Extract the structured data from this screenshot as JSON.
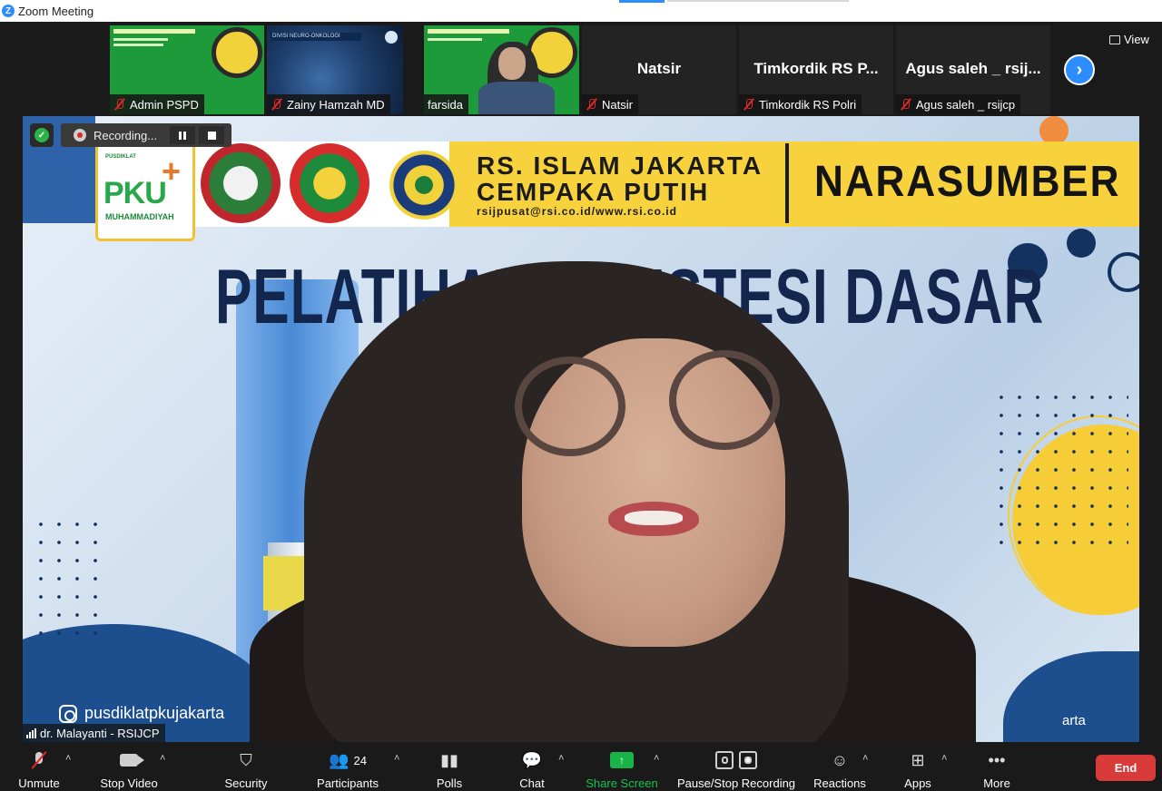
{
  "window": {
    "title": "Zoom Meeting"
  },
  "strip": {
    "tiles": [
      {
        "name": "Admin PSPD",
        "muted": true,
        "kind": "slide"
      },
      {
        "name": "Zainy Hamzah MD",
        "muted": true,
        "kind": "slide-brain",
        "slide_header": "DIVISI NEURO-ONKOLOGI"
      },
      {
        "name": "farsida",
        "muted": false,
        "kind": "video"
      },
      {
        "name": "Natsir",
        "display": "Natsir",
        "muted": true
      },
      {
        "name": "Timkordik RS Polri",
        "display": "Timkordik RS P...",
        "muted": true
      },
      {
        "name": "Agus saleh _ rsijcp",
        "display": "Agus saleh _ rsij...",
        "muted": true
      }
    ],
    "view_label": "View"
  },
  "recording": {
    "label": "Recording..."
  },
  "main_video": {
    "speaker": "dr. Malayanti - RSIJCP",
    "banner": {
      "pku_small": "PUSDIKLAT",
      "pku_big": "PKU",
      "pku_sub": "MUHAMMADIYAH",
      "hospital_line1": "RS. ISLAM JAKARTA",
      "hospital_line2": "CEMPAKA PUTIH",
      "hospital_url": "rsijpusat@rsi.co.id/www.rsi.co.id",
      "role": "NARASUMBER"
    },
    "headline": "PELATIHAN ANESTESI DASAR",
    "instagram": "pusdiklatpkujakarta",
    "corner_text": "arta"
  },
  "toolbar": {
    "unmute": "Unmute",
    "stop_video": "Stop Video",
    "security": "Security",
    "participants": "Participants",
    "participants_count": "24",
    "polls": "Polls",
    "chat": "Chat",
    "share_screen": "Share Screen",
    "pause_stop_recording": "Pause/Stop Recording",
    "reactions": "Reactions",
    "apps": "Apps",
    "more": "More",
    "end": "End"
  },
  "colors": {
    "accent": "#2d8cff",
    "end": "#d93b3b",
    "share": "#19b34a",
    "banner_yellow": "#f8d23d",
    "headline_navy": "#13264e"
  }
}
